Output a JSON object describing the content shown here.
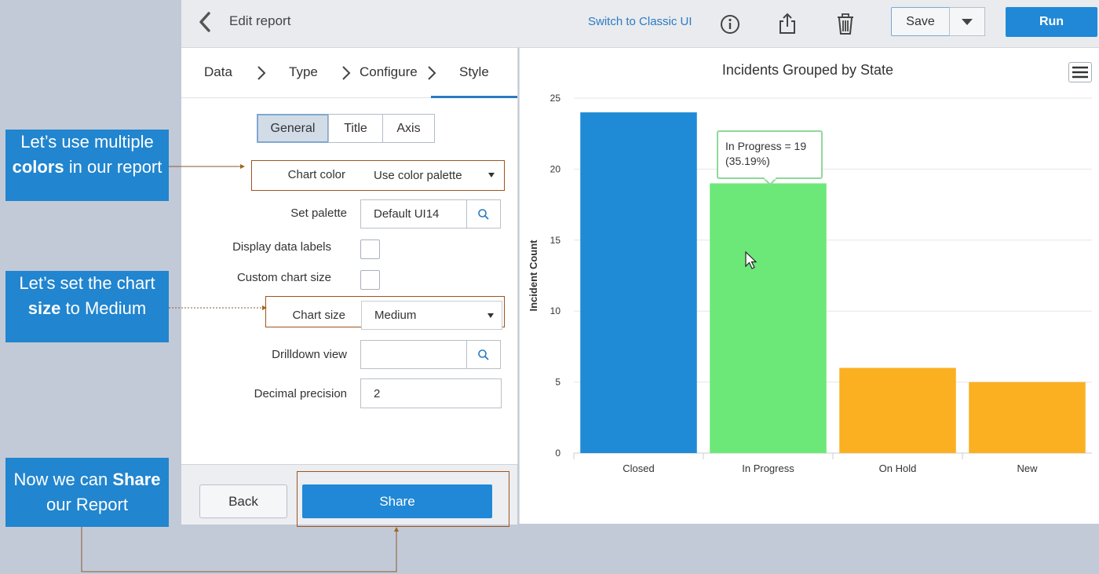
{
  "header": {
    "title": "Edit report",
    "classic_link": "Switch to Classic UI",
    "save_label": "Save",
    "run_label": "Run"
  },
  "steps": [
    {
      "label": "Data"
    },
    {
      "label": "Type"
    },
    {
      "label": "Configure"
    },
    {
      "label": "Style"
    }
  ],
  "tabs": {
    "general": "General",
    "title": "Title",
    "axis": "Axis"
  },
  "form": {
    "chart_color_label": "Chart color",
    "chart_color_value": "Use color palette",
    "set_palette_label": "Set palette",
    "set_palette_value": "Default UI14",
    "display_data_labels_label": "Display data labels",
    "custom_chart_size_label": "Custom chart size",
    "chart_size_label": "Chart size",
    "chart_size_value": "Medium",
    "drilldown_view_label": "Drilldown view",
    "drilldown_view_value": "",
    "decimal_precision_label": "Decimal precision",
    "decimal_precision_value": "2"
  },
  "footer": {
    "back_label": "Back",
    "share_label": "Share"
  },
  "callouts": {
    "c1_pre": "Let’s use multiple ",
    "c1_bold": "colors",
    "c1_post": " in our report",
    "c2_pre": "Let’s set the chart ",
    "c2_bold": "size",
    "c2_post": " to Medium",
    "c3_pre": "Now we can ",
    "c3_bold": "Share",
    "c3_post": " our Report"
  },
  "chart_data": {
    "type": "bar",
    "title": "Incidents Grouped by State",
    "ylabel": "Incident Count",
    "xlabel": "",
    "categories": [
      "Closed",
      "In Progress",
      "On Hold",
      "New"
    ],
    "values": [
      24,
      19,
      6,
      5
    ],
    "colors": [
      "#1f8bd6",
      "#6ce878",
      "#fbb022",
      "#fbb022"
    ],
    "ylim": [
      0,
      25
    ],
    "yticks": [
      0,
      5,
      10,
      15,
      20,
      25
    ],
    "grid": true,
    "tooltip": {
      "line1": "In Progress = 19",
      "line2": "(35.19%)"
    }
  }
}
